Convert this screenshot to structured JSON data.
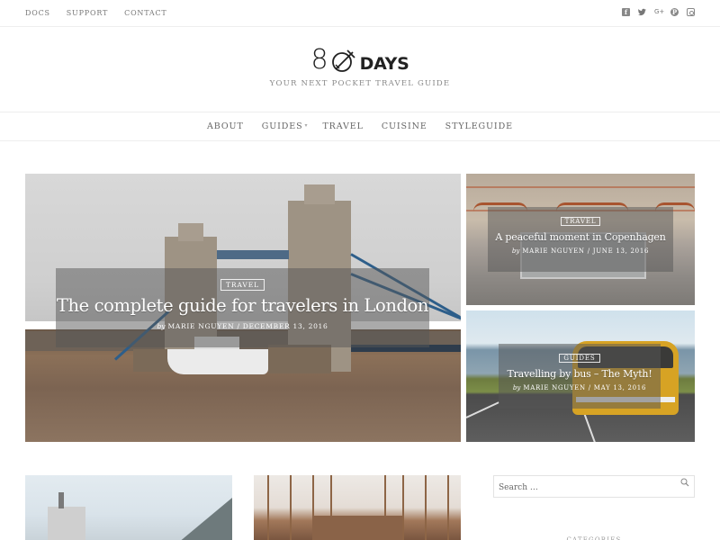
{
  "topbar": {
    "links": [
      "DOCS",
      "SUPPORT",
      "CONTACT"
    ],
    "social": [
      {
        "name": "facebook-icon",
        "glyph": "f"
      },
      {
        "name": "twitter-icon",
        "glyph": "🐦"
      },
      {
        "name": "google-plus-icon",
        "glyph": "G+"
      },
      {
        "name": "pinterest-icon",
        "glyph": "P"
      },
      {
        "name": "instagram-icon",
        "glyph": ""
      }
    ]
  },
  "brand": {
    "logo_number": "8",
    "logo_word": "DAYS",
    "tagline": "YOUR NEXT POCKET TRAVEL GUIDE"
  },
  "nav": {
    "items": [
      {
        "label": "ABOUT",
        "has_dropdown": false
      },
      {
        "label": "GUIDES",
        "has_dropdown": true
      },
      {
        "label": "TRAVEL",
        "has_dropdown": false
      },
      {
        "label": "CUISINE",
        "has_dropdown": false
      },
      {
        "label": "STYLEGUIDE",
        "has_dropdown": false
      }
    ],
    "dropdown_glyph": "⌄"
  },
  "featured": [
    {
      "category": "TRAVEL",
      "title": "The complete guide for travelers in London",
      "by": "by",
      "author": "MARIE NGUYEN",
      "separator": "/",
      "date": "DECEMBER 13, 2016"
    },
    {
      "category": "TRAVEL",
      "title": "A peaceful moment in Copenhagen",
      "by": "by",
      "author": "MARIE NGUYEN",
      "separator": "/",
      "date": "JUNE 13, 2016"
    },
    {
      "category": "GUIDES",
      "title": "Travelling by bus – The Myth!",
      "by": "by",
      "author": "MARIE NGUYEN",
      "separator": "/",
      "date": "MAY 13, 2016"
    }
  ],
  "sidebar": {
    "search_placeholder": "Search …",
    "widget_title": "CATEGORIES"
  }
}
